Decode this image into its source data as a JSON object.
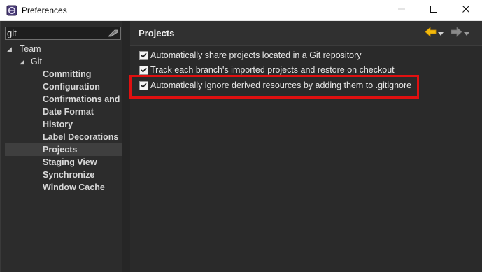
{
  "window": {
    "title": "Preferences",
    "app_icon": "eclipse-icon",
    "controls": [
      "minimize-icon",
      "maximize-icon",
      "close-icon"
    ]
  },
  "filter": {
    "value": "git",
    "clear_icon": "clear-eraser-icon"
  },
  "tree": {
    "items": [
      {
        "label": "Team",
        "level": 0,
        "expanded": true
      },
      {
        "label": "Git",
        "level": 1,
        "expanded": true
      },
      {
        "label": "Committing",
        "level": 2
      },
      {
        "label": "Configuration",
        "level": 2
      },
      {
        "label": "Confirmations and W",
        "level": 2
      },
      {
        "label": "Date Format",
        "level": 2
      },
      {
        "label": "History",
        "level": 2
      },
      {
        "label": "Label Decorations",
        "level": 2
      },
      {
        "label": "Projects",
        "level": 2,
        "selected": true
      },
      {
        "label": "Staging View",
        "level": 2
      },
      {
        "label": "Synchronize",
        "level": 2
      },
      {
        "label": "Window Cache",
        "level": 2
      }
    ]
  },
  "page": {
    "title": "Projects",
    "nav": {
      "back_icon": "arrow-left-icon",
      "forward_icon": "arrow-right-icon",
      "menu_icon": "chevron-down-icon",
      "back_color": "#f2b90c",
      "forward_color": "#8a8a8a"
    },
    "options": [
      {
        "label": "Automatically share projects located in a Git repository",
        "checked": true
      },
      {
        "label": "Track each branch's imported projects and restore on checkout",
        "checked": true
      },
      {
        "label": "Automatically ignore derived resources by adding them to .gitignore",
        "checked": true
      }
    ]
  },
  "colors": {
    "highlight": "#e01010",
    "selection": "#3f3f3f",
    "background": "#2a2a2a"
  }
}
